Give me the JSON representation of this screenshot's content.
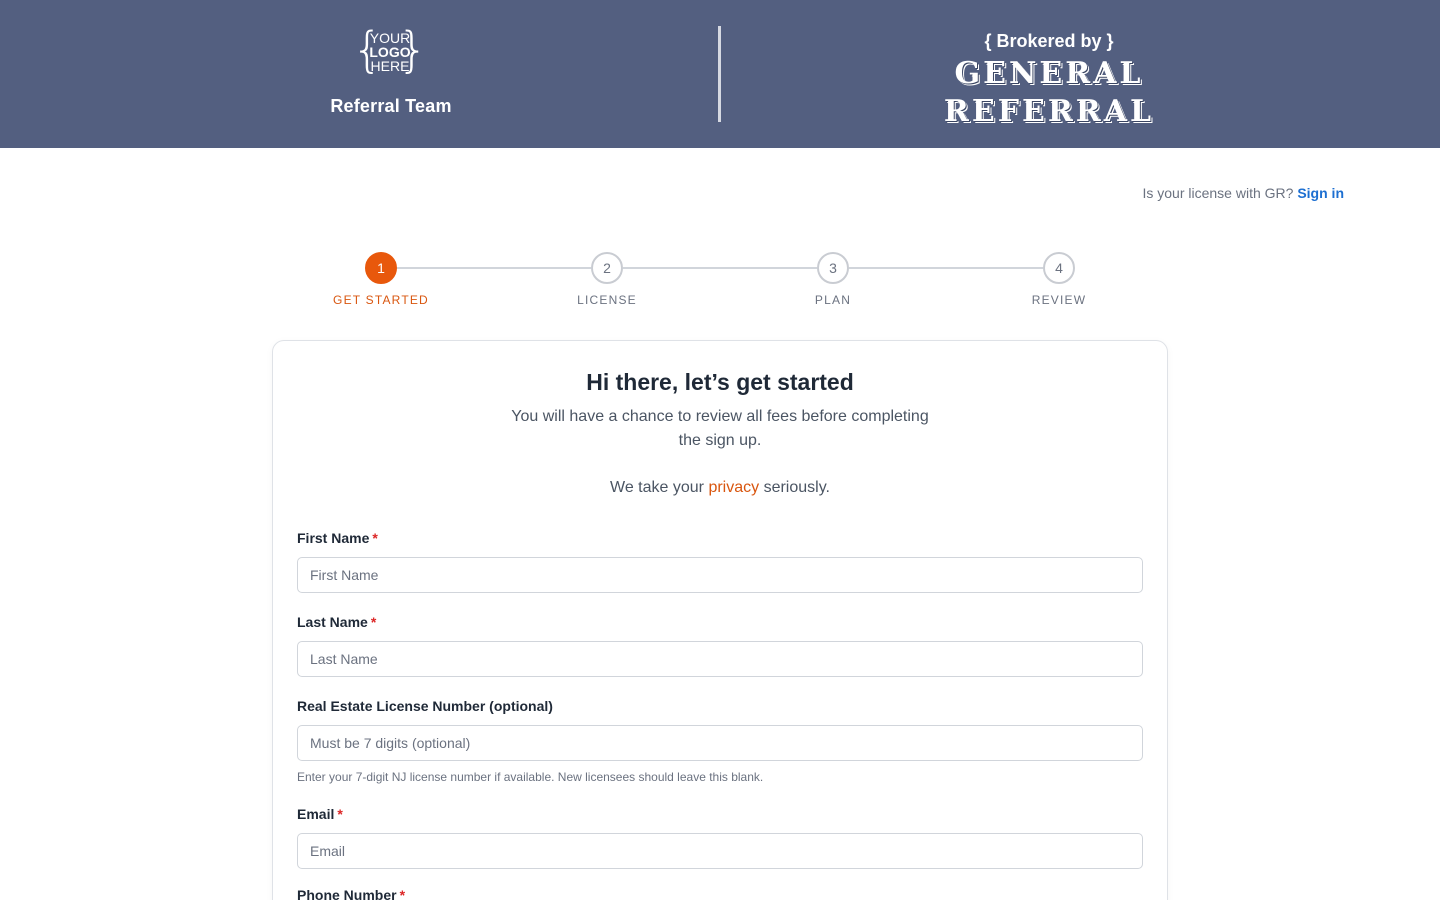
{
  "header": {
    "logo": {
      "line1": "YOUR",
      "line2": "LOGO",
      "line3": "HERE"
    },
    "team_name": "Referral Team",
    "brokered_by": "{ Brokered by }",
    "brand_line1": "GENERAL",
    "brand_line2": "REFERRAL",
    "background_color": "#535f80"
  },
  "signin": {
    "prompt": "Is your license with GR?",
    "link_label": "Sign in"
  },
  "stepper": {
    "active_index": 0,
    "active_color": "#e8580c",
    "steps": [
      {
        "number": "1",
        "label": "GET STARTED"
      },
      {
        "number": "2",
        "label": "LICENSE"
      },
      {
        "number": "3",
        "label": "PLAN"
      },
      {
        "number": "4",
        "label": "REVIEW"
      }
    ]
  },
  "card": {
    "title": "Hi there, let’s get started",
    "subtitle": "You will have a chance to review all fees before completing the sign up.",
    "privacy_prefix": "We take your",
    "privacy_link": "privacy",
    "privacy_suffix": "seriously."
  },
  "form": {
    "first_name": {
      "label": "First Name",
      "required_mark": "*",
      "placeholder": "First Name",
      "value": ""
    },
    "last_name": {
      "label": "Last Name",
      "required_mark": "*",
      "placeholder": "Last Name",
      "value": ""
    },
    "license": {
      "label": "Real Estate License Number (optional)",
      "placeholder": "Must be 7 digits (optional)",
      "value": "",
      "help": "Enter your 7-digit NJ license number if available. New licensees should leave this blank."
    },
    "email": {
      "label": "Email",
      "required_mark": "*",
      "placeholder": "Email",
      "value": ""
    },
    "phone": {
      "label": "Phone Number",
      "required_mark": "*"
    }
  }
}
